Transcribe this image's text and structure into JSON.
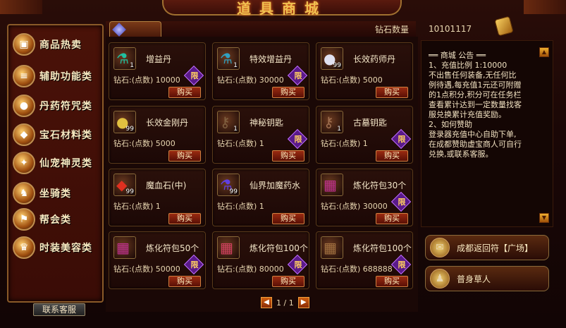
{
  "header": {
    "title": "道具商城"
  },
  "diamond": {
    "label": "钻石数量",
    "value": "10101117"
  },
  "sidebar": {
    "items": [
      {
        "label": "商品热卖",
        "icon": "chest-icon"
      },
      {
        "label": "辅助功能类",
        "icon": "book-icon"
      },
      {
        "label": "丹药符咒类",
        "icon": "pill-icon"
      },
      {
        "label": "宝石材料类",
        "icon": "gem-icon"
      },
      {
        "label": "仙宠神灵类",
        "icon": "pet-icon"
      },
      {
        "label": "坐骑类",
        "icon": "horse-icon"
      },
      {
        "label": "帮会类",
        "icon": "guild-icon"
      },
      {
        "label": "时装美容类",
        "icon": "costume-icon"
      }
    ],
    "contact": "联系客服"
  },
  "products": [
    {
      "name": "增益丹",
      "price": "钻石:(点数) 10000",
      "buy": "购买",
      "limited": "限",
      "count": "1",
      "badge": "利",
      "color": "#20c0a0"
    },
    {
      "name": "特效增益丹",
      "price": "钻石:(点数) 30000",
      "buy": "购买",
      "limited": "限",
      "count": "1",
      "badge": "利",
      "color": "#30a0c0"
    },
    {
      "name": "长效药师丹",
      "price": "钻石:(点数) 5000",
      "buy": "购买",
      "limited": "",
      "count": "99",
      "badge": "",
      "color": "#e0e0f0"
    },
    {
      "name": "长效金刚丹",
      "price": "钻石:(点数) 5000",
      "buy": "购买",
      "limited": "",
      "count": "99",
      "badge": "",
      "color": "#e0c040"
    },
    {
      "name": "神秘钥匙",
      "price": "钻石:(点数) 1",
      "buy": "购买",
      "limited": "限",
      "count": "1",
      "badge": "",
      "color": "#806040"
    },
    {
      "name": "古墓钥匙",
      "price": "钻石:(点数) 1",
      "buy": "购买",
      "limited": "限",
      "count": "1",
      "badge": "",
      "color": "#a07050"
    },
    {
      "name": "魔血石(中)",
      "price": "钻石:(点数) 1",
      "buy": "购买",
      "limited": "",
      "count": "99",
      "badge": "",
      "color": "#e03020"
    },
    {
      "name": "仙界加魔药水",
      "price": "钻石:(点数) 1",
      "buy": "购买",
      "limited": "",
      "count": "99",
      "badge": "",
      "color": "#6040e0"
    },
    {
      "name": "炼化符包30个",
      "price": "钻石:(点数) 30000",
      "buy": "购买",
      "limited": "限",
      "count": "",
      "badge": "",
      "color": "#c03090"
    },
    {
      "name": "炼化符包50个",
      "price": "钻石:(点数) 50000",
      "buy": "购买",
      "limited": "限",
      "count": "",
      "badge": "",
      "color": "#c03090"
    },
    {
      "name": "炼化符包100个",
      "price": "钻石:(点数) 80000",
      "buy": "购买",
      "limited": "限",
      "count": "",
      "badge": "",
      "color": "#d04060"
    },
    {
      "name": "炼化符包100个",
      "price": "钻石:(点数) 688888",
      "buy": "购买",
      "limited": "限",
      "count": "",
      "badge": "",
      "color": "#a07040"
    }
  ],
  "pager": {
    "text": "1 / 1",
    "prev": "◀",
    "next": "▶"
  },
  "notice": {
    "title": "══ 商城 公告 ══",
    "lines": [
      "1、充值比例 1:10000",
      "不出售任何装备,无任何比",
      "例待遇,每充值1元还可附赠",
      "的1点积分,积分可在任务栏",
      "查看累计达到一定数量找客",
      "服兑换累计充值奖励。",
      "2、如何赞助",
      "登录器充值中心自助下单,",
      "在成都赞助虚宝商人可自行",
      "兑换,或联系客服。"
    ],
    "scroll_up": "▲",
    "scroll_down": "▼"
  },
  "quick": [
    {
      "label": "成都返回符【广场】",
      "icon": "scroll-icon"
    },
    {
      "label": "普身草人",
      "icon": "scarecrow-icon"
    }
  ]
}
